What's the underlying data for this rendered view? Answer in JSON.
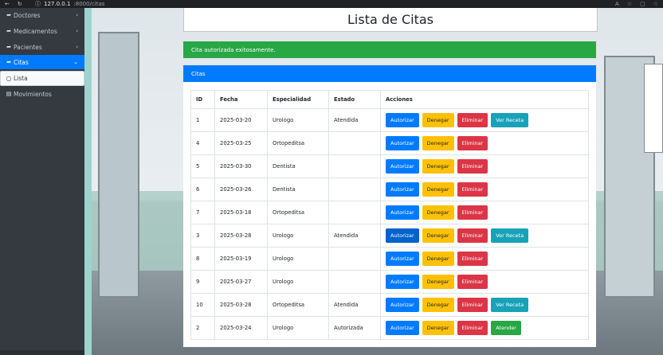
{
  "browser": {
    "url_host": "127.0.0.1",
    "url_path": ":8000/citas"
  },
  "sidebar": {
    "items": [
      {
        "label": "Doctores",
        "icon": "share-arrow-icon",
        "chevron": "‹"
      },
      {
        "label": "Medicamentos",
        "icon": "share-arrow-icon",
        "chevron": "‹"
      },
      {
        "label": "Pacientes",
        "icon": "share-arrow-icon",
        "chevron": "‹"
      },
      {
        "label": "Citas",
        "icon": "share-arrow-icon",
        "chevron": "⌄"
      }
    ],
    "sub_items": [
      {
        "label": "Lista",
        "icon": "circle-icon"
      }
    ],
    "extra_items": [
      {
        "label": "Movimientos",
        "icon": "document-icon"
      }
    ]
  },
  "page": {
    "title": "Lista de Citas",
    "alert": "Cita autorizada exitosamente.",
    "card_header": "Citas"
  },
  "table": {
    "headers": [
      "ID",
      "Fecha",
      "Especialidad",
      "Estado",
      "Acciones"
    ],
    "rows": [
      {
        "id": "1",
        "fecha": "2025-03-20",
        "especialidad": "Urologo",
        "estado": "Atendida",
        "actions": [
          "Autorizar",
          "Denegar",
          "Eliminar",
          "Ver Receta"
        ]
      },
      {
        "id": "4",
        "fecha": "2025-03-25",
        "especialidad": "Ortopeditsa",
        "estado": "",
        "actions": [
          "Autorizar",
          "Denegar",
          "Eliminar"
        ]
      },
      {
        "id": "5",
        "fecha": "2025-03-30",
        "especialidad": "Dentista",
        "estado": "",
        "actions": [
          "Autorizar",
          "Denegar",
          "Eliminar"
        ]
      },
      {
        "id": "6",
        "fecha": "2025-03-26",
        "especialidad": "Dentista",
        "estado": "",
        "actions": [
          "Autorizar",
          "Denegar",
          "Eliminar"
        ]
      },
      {
        "id": "7",
        "fecha": "2025-03-18",
        "especialidad": "Ortopeditsa",
        "estado": "",
        "actions": [
          "Autorizar",
          "Denegar",
          "Eliminar"
        ]
      },
      {
        "id": "3",
        "fecha": "2025-03-28",
        "especialidad": "Urologo",
        "estado": "Atendida",
        "actions": [
          "Autorizar",
          "Denegar",
          "Eliminar",
          "Ver Receta"
        ]
      },
      {
        "id": "8",
        "fecha": "2025-03-19",
        "especialidad": "Urologo",
        "estado": "",
        "actions": [
          "Autorizar",
          "Denegar",
          "Eliminar"
        ]
      },
      {
        "id": "9",
        "fecha": "2025-03-27",
        "especialidad": "Urologo",
        "estado": "",
        "actions": [
          "Autorizar",
          "Denegar",
          "Eliminar"
        ]
      },
      {
        "id": "10",
        "fecha": "2025-03-28",
        "especialidad": "Ortopeditsa",
        "estado": "Atendida",
        "actions": [
          "Autorizar",
          "Denegar",
          "Eliminar",
          "Ver Receta"
        ]
      },
      {
        "id": "2",
        "fecha": "2025-03-24",
        "especialidad": "Urologo",
        "estado": "Autorizada",
        "actions": [
          "Autorizar",
          "Denegar",
          "Eliminar",
          "Atender"
        ]
      }
    ]
  },
  "colors": {
    "primary": "#007bff",
    "success": "#28a745",
    "warning": "#ffc107",
    "danger": "#dc3545",
    "info": "#17a2b8",
    "sidebar": "#343a40"
  }
}
